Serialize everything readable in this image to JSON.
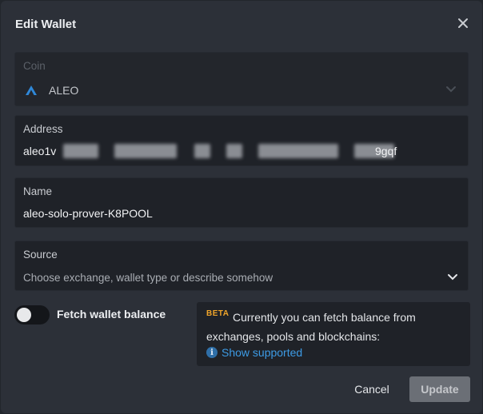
{
  "dialog": {
    "title": "Edit Wallet"
  },
  "coin": {
    "label": "Coin",
    "value": "ALEO"
  },
  "address": {
    "label": "Address",
    "prefix": "aleo1v",
    "suffix": "9gqf"
  },
  "name": {
    "label": "Name",
    "value": "aleo-solo-prover-K8POOL"
  },
  "source": {
    "label": "Source",
    "placeholder": "Choose exchange, wallet type or describe somehow"
  },
  "fetch_balance": {
    "label": "Fetch wallet balance",
    "enabled": false
  },
  "info": {
    "badge": "BETA",
    "text": "Currently you can fetch balance from exchanges, pools and blockchains:",
    "link": "Show supported",
    "link_icon": "i"
  },
  "actions": {
    "cancel": "Cancel",
    "update": "Update"
  },
  "colors": {
    "link": "#3d9be5",
    "beta": "#f0a52a",
    "coin_icon": "#2f88d8"
  }
}
